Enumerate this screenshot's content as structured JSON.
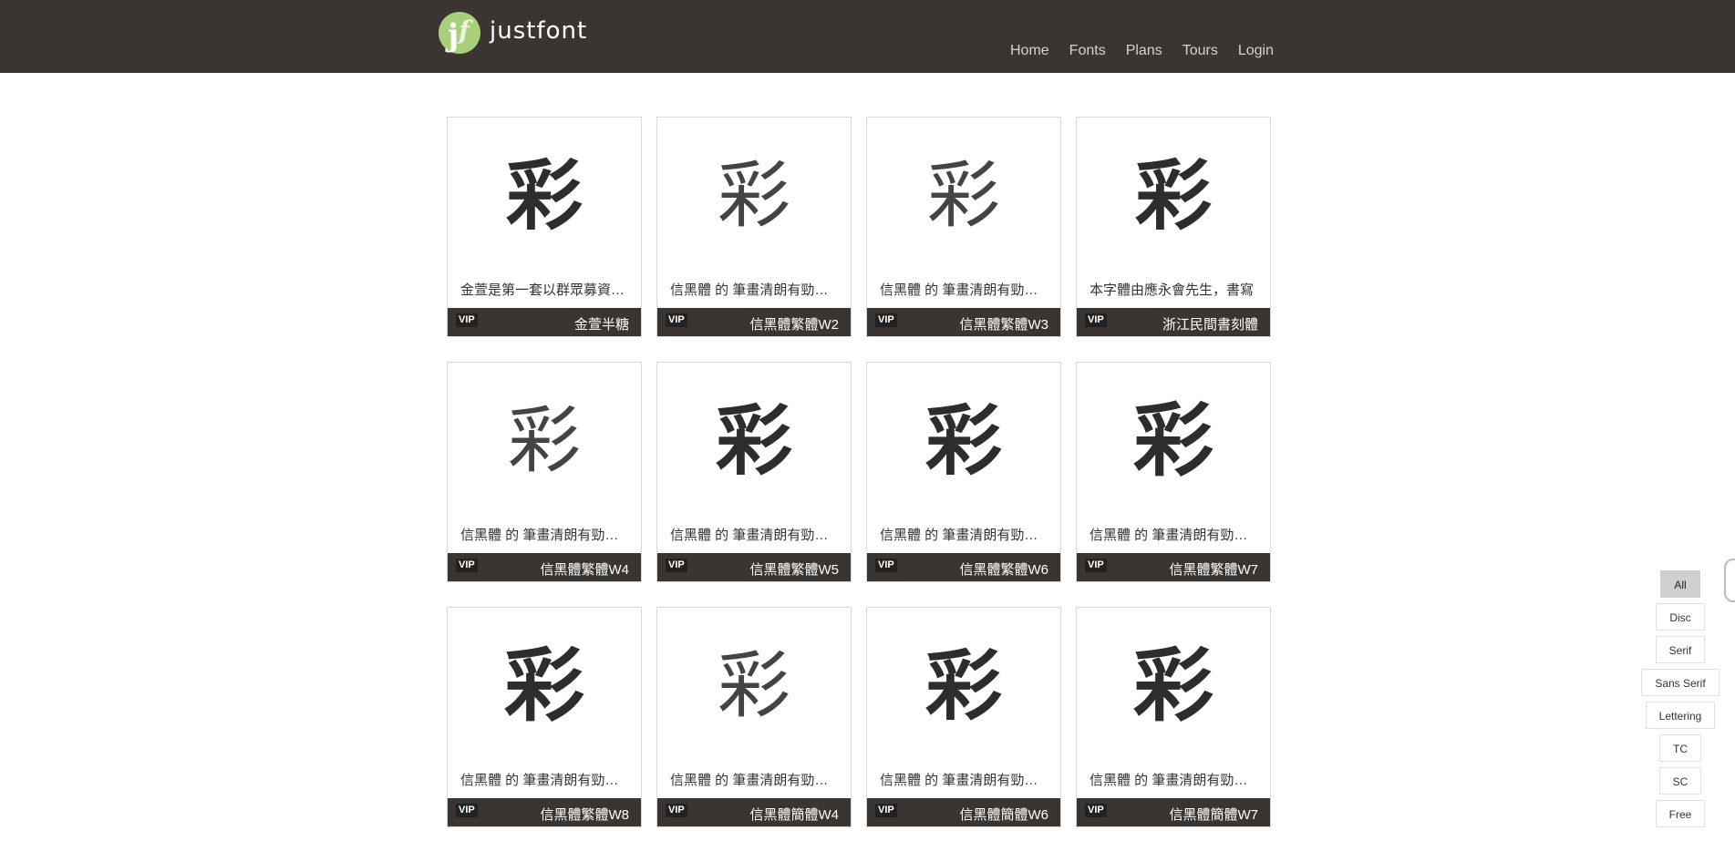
{
  "brand": {
    "name": "justfont",
    "mark_j": "j",
    "mark_f": "f",
    "accent": "#a8cf7a"
  },
  "nav": [
    "Home",
    "Fonts",
    "Plans",
    "Tours",
    "Login"
  ],
  "cards": [
    {
      "glyph": "彩",
      "weight": "bold",
      "desc": "金萱是第一套以群眾募資方式完成的字型",
      "badge": "VIP",
      "name": "金萱半糖"
    },
    {
      "glyph": "彩",
      "weight": "light",
      "desc": "信黑體 的 筆畫清朗有勁，字面寬大",
      "badge": "VIP",
      "name": "信黑體繁體W2"
    },
    {
      "glyph": "彩",
      "weight": "light",
      "desc": "信黑體 的 筆畫清朗有勁，字面寬大",
      "badge": "VIP",
      "name": "信黑體繁體W3"
    },
    {
      "glyph": "彩",
      "weight": "bold",
      "desc": "本字體由應永會先生，書寫",
      "badge": "VIP",
      "name": "浙江民間書刻體"
    },
    {
      "glyph": "彩",
      "weight": "light",
      "desc": "信黑體 的 筆畫清朗有勁，字面寬大",
      "badge": "VIP",
      "name": "信黑體繁體W4"
    },
    {
      "glyph": "彩",
      "weight": "bold",
      "desc": "信黑體 的 筆畫清朗有勁，字面寬大",
      "badge": "VIP",
      "name": "信黑體繁體W5"
    },
    {
      "glyph": "彩",
      "weight": "bold",
      "desc": "信黑體 的 筆畫清朗有勁，字面寬大",
      "badge": "VIP",
      "name": "信黑體繁體W6"
    },
    {
      "glyph": "彩",
      "weight": "heavy",
      "desc": "信黑體 的 筆畫清朗有勁，字面寬大",
      "badge": "VIP",
      "name": "信黑體繁體W7"
    },
    {
      "glyph": "彩",
      "weight": "heavy",
      "desc": "信黑體 的 筆畫清朗有勁，字面寬大",
      "badge": "VIP",
      "name": "信黑體繁體W8"
    },
    {
      "glyph": "彩",
      "weight": "light",
      "desc": "信黑體 的 筆畫清朗有勁，字面寬大",
      "badge": "VIP",
      "name": "信黑體簡體W4"
    },
    {
      "glyph": "彩",
      "weight": "bold",
      "desc": "信黑體 的 筆畫清朗有勁，字面寬大",
      "badge": "VIP",
      "name": "信黑體簡體W6"
    },
    {
      "glyph": "彩",
      "weight": "heavy",
      "desc": "信黑體 的 筆畫清朗有勁，字面寬大",
      "badge": "VIP",
      "name": "信黑體簡體W7"
    }
  ],
  "filters": [
    "All",
    "Disc",
    "Serif",
    "Sans Serif",
    "Lettering",
    "TC",
    "SC",
    "Free"
  ],
  "active_filter": "All",
  "colors": {
    "header_bg": "#3b3531",
    "card_foot_bg": "#3b3531",
    "active_filter_bg": "#cfcfcf"
  }
}
